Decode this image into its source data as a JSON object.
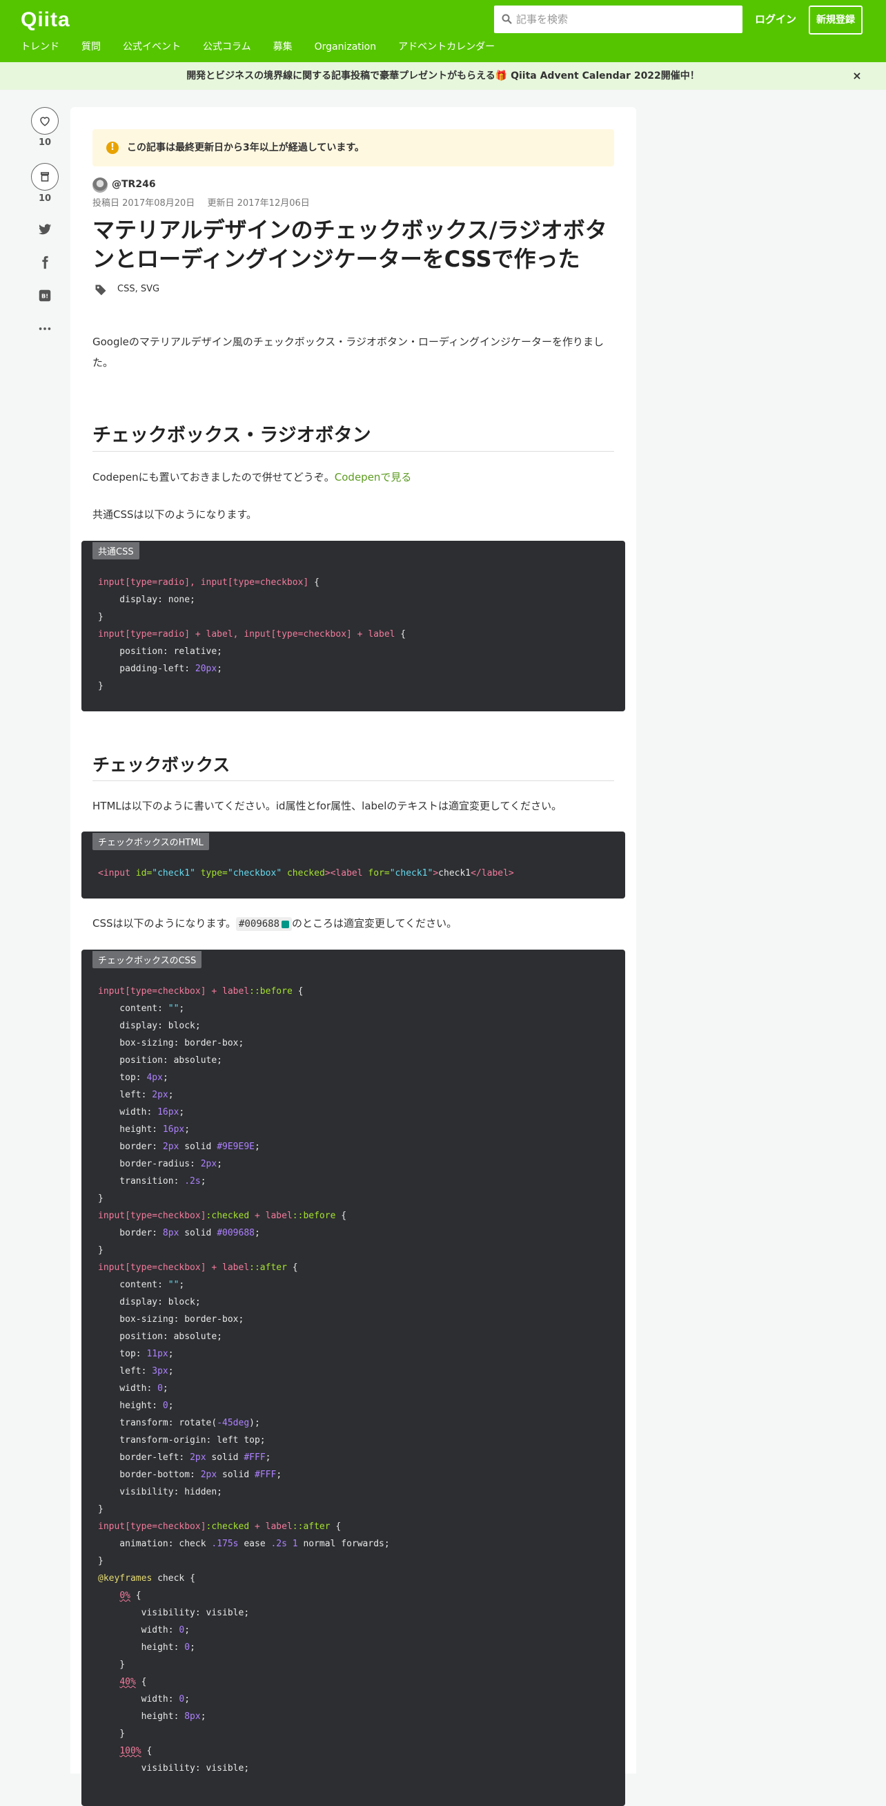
{
  "header": {
    "logo": "Qiita",
    "search_placeholder": "記事を検索",
    "login": "ログイン",
    "signup": "新規登録",
    "nav": [
      "トレンド",
      "質問",
      "公式イベント",
      "公式コラム",
      "募集",
      "Organization",
      "アドベントカレンダー"
    ]
  },
  "banner": {
    "text": "開発とビジネスの境界線に関する記事投稿で豪華プレゼントがもらえる🎁 Qiita Advent Calendar 2022開催中！",
    "close": "×"
  },
  "sidebar": {
    "likes": "10",
    "stocks": "10"
  },
  "article": {
    "warning": "この記事は最終更新日から3年以上が経過しています。",
    "author": "@TR246",
    "posted": "投稿日 2017年08月20日",
    "updated": "更新日 2017年12月06日",
    "title": "マテリアルデザインのチェックボックス/ラジオボタンとローディングインジケーターをCSSで作った",
    "tags": "CSS, SVG",
    "intro": "Googleのマテリアルデザイン風のチェックボックス・ラジオボタン・ローディングインジケーターを作りました。",
    "h2_1": "チェックボックス・ラジオボタン",
    "codepen_text": "Codepenにも置いておきましたので併せてどうぞ。",
    "codepen_link": "Codepenで見る",
    "common_css_text": "共通CSSは以下のようになります。",
    "code1_label": "共通CSS",
    "h3_1": "チェックボックス",
    "html_text": "HTMLは以下のように書いてください。id属性とfor属性、labelのテキストは適宜変更してください。",
    "code2_label": "チェックボックスのHTML",
    "css_text_before": "CSSは以下のようになります。",
    "css_text_code": "#009688",
    "css_text_after": "のところは適宜変更してください。",
    "code3_label": "チェックボックスのCSS"
  },
  "colors": {
    "brand": "#55c500",
    "accent": "#009688"
  }
}
